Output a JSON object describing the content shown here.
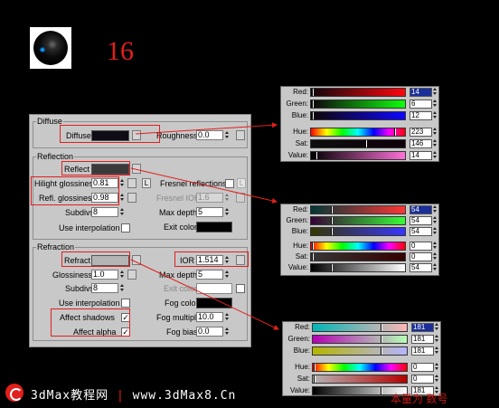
{
  "header": {
    "number": "16"
  },
  "panel": {
    "diffuse": {
      "title": "Diffuse",
      "diffuse_label": "Diffuse",
      "roughness_label": "Roughness",
      "roughness_value": "0.0",
      "diffuse_color": "#0e0c14"
    },
    "reflection": {
      "title": "Reflection",
      "reflect_label": "Reflect",
      "reflect_color": "#3a3a3a",
      "hilight_label": "Hilight glossiness",
      "hilight_value": "0.81",
      "refl_label": "Refl. glossiness",
      "refl_value": "0.98",
      "l_label": "L",
      "fresnel_label": "Fresnel reflections",
      "fresnel_ior_label": "Fresnel IOR",
      "fresnel_ior_value": "1.6",
      "subdivs_label": "Subdivs",
      "subdivs_value": "8",
      "maxdepth_label": "Max depth",
      "maxdepth_value": "5",
      "interp_label": "Use interpolation",
      "exit_label": "Exit color",
      "exit_color": "#000000"
    },
    "refraction": {
      "title": "Refraction",
      "refract_label": "Refract",
      "refract_color": "#b5b5b5",
      "ior_label": "IOR",
      "ior_value": "1.514",
      "gloss_label": "Glossiness",
      "gloss_value": "1.0",
      "maxdepth_label": "Max depth",
      "maxdepth_value": "5",
      "subdivs_label": "Subdivs",
      "subdivs_value": "8",
      "exit_label": "Exit color",
      "interp_label": "Use interpolation",
      "fogcolor_label": "Fog color",
      "fog_color": "#000000",
      "affect_shadows_label": "Affect shadows",
      "fogmult_label": "Fog multiplier",
      "fogmult_value": "10.0",
      "affect_alpha_label": "Affect alpha",
      "fogbias_label": "Fog bias",
      "fogbias_value": "0.0",
      "check_mark": "✓"
    }
  },
  "color_pickers": [
    {
      "name": "diffuse",
      "rows": [
        {
          "label": "Red:",
          "value": "14"
        },
        {
          "label": "Green:",
          "value": "6"
        },
        {
          "label": "Blue:",
          "value": "12"
        },
        {
          "label": "Hue:",
          "value": "223"
        },
        {
          "label": "Sat:",
          "value": "146"
        },
        {
          "label": "Value:",
          "value": "14"
        }
      ]
    },
    {
      "name": "reflect",
      "rows": [
        {
          "label": "Red:",
          "value": "54"
        },
        {
          "label": "Green:",
          "value": "54"
        },
        {
          "label": "Blue:",
          "value": "54"
        },
        {
          "label": "Hue:",
          "value": "0"
        },
        {
          "label": "Sat:",
          "value": "0"
        },
        {
          "label": "Value:",
          "value": "54"
        }
      ]
    },
    {
      "name": "refract",
      "rows": [
        {
          "label": "Red:",
          "value": "181"
        },
        {
          "label": "Green:",
          "value": "181"
        },
        {
          "label": "Blue:",
          "value": "181"
        },
        {
          "label": "Hue:",
          "value": "0"
        },
        {
          "label": "Sat:",
          "value": "0"
        },
        {
          "label": "Value:",
          "value": "181"
        }
      ]
    }
  ],
  "footer": {
    "site_name": "3dMax教程网",
    "separator": "|",
    "site_url": "www.3dMax8.Cn",
    "right_text": "本量为 数号"
  }
}
